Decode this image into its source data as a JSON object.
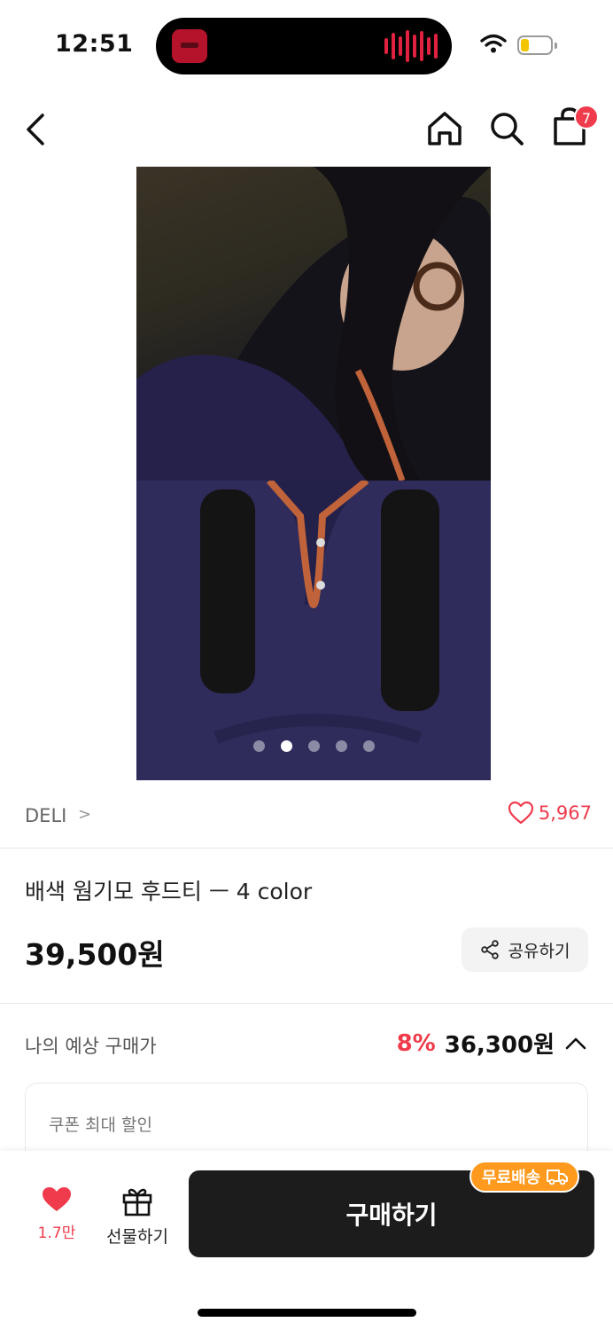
{
  "status_bar": {
    "time": "12:51"
  },
  "nav": {
    "cart_count": "7"
  },
  "gallery": {
    "dot_count": 5,
    "active_index": 1
  },
  "brand": {
    "name": "DELI",
    "chevron": ">",
    "likes": "5,967"
  },
  "product": {
    "title": "배색 웜기모 후드티 ㅡ 4 color",
    "price": "39,500원"
  },
  "share": {
    "label": "공유하기"
  },
  "estimate": {
    "label": "나의 예상 구매가",
    "percent": "8%",
    "price": "36,300원"
  },
  "coupon": {
    "label": "쿠폰 최대 할인"
  },
  "bottom_bar": {
    "wish_count": "1.7만",
    "gift_label": "선물하기",
    "buy_label": "구매하기",
    "free_shipping": "무료배송"
  },
  "colors": {
    "accent": "#ef3b4c",
    "buy_button": "#1c1c1c",
    "free_shipping": "#ff9a1f"
  }
}
